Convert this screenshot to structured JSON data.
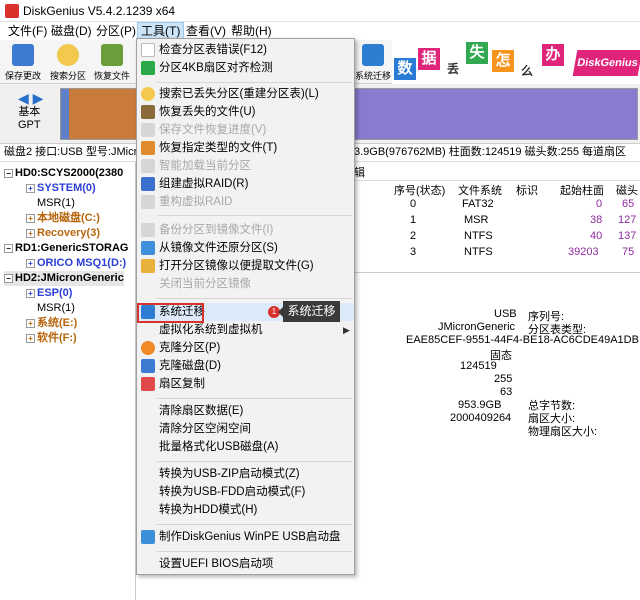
{
  "window": {
    "title": "DiskGenius V5.4.2.1239 x64"
  },
  "menubar": [
    {
      "label": "文件(F)"
    },
    {
      "label": "磁盘(D)"
    },
    {
      "label": "分区(P)"
    },
    {
      "label": "工具(T)"
    },
    {
      "label": "查看(V)"
    },
    {
      "label": "帮助(H)"
    }
  ],
  "toolbar": {
    "save": "保存更改",
    "search": "搜索分区",
    "recover": "恢复文件",
    "migrate": "系统迁移"
  },
  "banner": {
    "chars": [
      "数",
      "据",
      "丢",
      "失",
      "怎",
      "么",
      "办"
    ],
    "brand": "DiskGenius"
  },
  "diskmap": {
    "type_line1": "基本",
    "type_line2": "GPT"
  },
  "infoline": {
    "left": "磁盘2 接口:USB  型号:JMicron",
    "right": "3.9GB(976762MB)  柱面数:124519  磁头数:255  每道扇区数:"
  },
  "tree": {
    "nodes": [
      {
        "label": "HD0:SCYS2000(2380"
      },
      {
        "label": "SYSTEM(0)"
      },
      {
        "label": "MSR(1)"
      },
      {
        "label": "本地磁盘(C:)"
      },
      {
        "label": "Recovery(3)"
      },
      {
        "label": "RD1:GenericSTORAG"
      },
      {
        "label": "ORICO MSQ1(D:)"
      },
      {
        "label": "HD2:JMicronGeneric"
      },
      {
        "label": "ESP(0)"
      },
      {
        "label": "MSR(1)"
      },
      {
        "label": "系统(E:)"
      },
      {
        "label": "软件(F:)"
      }
    ]
  },
  "table": {
    "tab": "辑",
    "headers": [
      "序号(状态)",
      "文件系统",
      "标识",
      "起始柱面",
      "磁头"
    ],
    "rows": [
      {
        "idx": "0",
        "fs": "FAT32",
        "id": "",
        "cyl": "0",
        "head": "65"
      },
      {
        "idx": "1",
        "fs": "MSR",
        "id": "",
        "cyl": "38",
        "head": "127"
      },
      {
        "idx": "2",
        "fs": "NTFS",
        "id": "",
        "cyl": "40",
        "head": "137"
      },
      {
        "idx": "3",
        "fs": "NTFS",
        "id": "",
        "cyl": "39203",
        "head": "75"
      }
    ]
  },
  "details": {
    "usb": "USB",
    "model": "JMicronGeneric",
    "guid": "EAE85CEF-9551-44F4-BE18-AC6CDE49A1DB",
    "status": "固态",
    "serial_label": "序列号:",
    "parttype_label": "分区表类型:",
    "cylinders": "124519",
    "heads": "255",
    "sectors": "63",
    "capacity": "953.9GB",
    "total_sectors": "2000409264",
    "total_bytes_label": "总字节数:",
    "sector_size_label": "扇区大小:",
    "phys_sector_label": "物理扇区大小:"
  },
  "tools_menu": {
    "items": [
      {
        "label": "检查分区表错误(F12)"
      },
      {
        "label": "分区4KB扇区对齐检测"
      },
      {
        "label": "搜索已丢失分区(重建分区表)(L)"
      },
      {
        "label": "恢复丢失的文件(U)"
      },
      {
        "label": "保存文件恢复进度(V)"
      },
      {
        "label": "恢复指定类型的文件(T)"
      },
      {
        "label": "智能加载当前分区"
      },
      {
        "label": "组建虚拟RAID(R)"
      },
      {
        "label": "重构虚拟RAID"
      },
      {
        "label": "备份分区到镜像文件(I)"
      },
      {
        "label": "从镜像文件还原分区(S)"
      },
      {
        "label": "打开分区镜像以便提取文件(G)"
      },
      {
        "label": "关闭当前分区镜像"
      },
      {
        "label": "系统迁移"
      },
      {
        "label": "虚拟化系统到虚拟机"
      },
      {
        "label": "克隆分区(P)"
      },
      {
        "label": "克隆磁盘(D)"
      },
      {
        "label": "扇区复制"
      },
      {
        "label": "清除扇区数据(E)"
      },
      {
        "label": "清除分区空闲空间"
      },
      {
        "label": "批量格式化USB磁盘(A)"
      },
      {
        "label": "转换为USB-ZIP启动模式(Z)"
      },
      {
        "label": "转换为USB-FDD启动模式(F)"
      },
      {
        "label": "转换为HDD模式(H)"
      },
      {
        "label": "制作DiskGenius WinPE USB启动盘"
      },
      {
        "label": "设置UEFI BIOS启动项"
      }
    ]
  },
  "annotation": {
    "badge": "1",
    "tooltip": "系统迁移"
  },
  "colors": {
    "accent": "#d9322c",
    "tree_blue": "#2a3fd6",
    "tree_orange": "#b8660e",
    "value_purple": "#8e2a9e"
  }
}
